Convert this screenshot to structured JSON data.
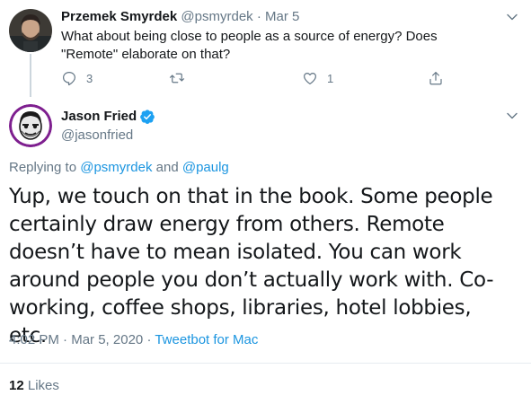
{
  "reply_tweet": {
    "name": "Przemek Smyrdek",
    "handle": "@psmyrdek",
    "separator": "·",
    "date": "Mar 5",
    "text": "What about being close to people as a source of energy? Does \"Remote\" elaborate on that?",
    "actions": {
      "reply_icon": "reply-icon",
      "reply_count": "3",
      "retweet_icon": "retweet-icon",
      "like_icon": "heart-icon",
      "like_count": "1",
      "share_icon": "share-icon"
    }
  },
  "main_tweet": {
    "name": "Jason Fried",
    "handle": "@jasonfried",
    "verified": true,
    "replying_prefix": "Replying to",
    "replying_to_1": "@psmyrdek",
    "replying_and": "and",
    "replying_to_2": "@paulg",
    "text": "Yup, we touch on that in the book. Some people certainly draw energy from others. Remote doesn’t have to mean isolated. You can work around people you don’t actually work with. Co-working, coffee shops, libraries, hotel lobbies, etc.",
    "time": "4:02 PM",
    "date": "Mar 5, 2020",
    "separator": "·",
    "source": "Tweetbot for Mac",
    "likes_count": "12",
    "likes_label": "Likes"
  },
  "colors": {
    "accent": "#1b95e0",
    "verified": "#1da1f2",
    "muted": "#657786",
    "text": "#14171a",
    "divider": "#e6ecf0"
  }
}
